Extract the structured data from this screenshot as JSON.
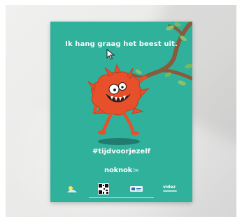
{
  "poster": {
    "headline": "Ik hang graag het beest uit.",
    "hashtag": "#tijdvoorjezelf",
    "brand_name": "noknok",
    "brand_tld": ".be",
    "footer_logo_text": "videz"
  },
  "colors": {
    "poster_bg": "#2fb19c",
    "monster": "#e8502b",
    "monster_dark": "#c93d1f",
    "branch": "#8a5a3b",
    "leaves": "#8ac26b",
    "text": "#ffffff"
  },
  "icons": {
    "cursor": "mouse-pointer-icon",
    "qr": "qr-code-icon",
    "logo_left": "partner-logo-icon",
    "logo_mid": "partner-logo-icon"
  }
}
